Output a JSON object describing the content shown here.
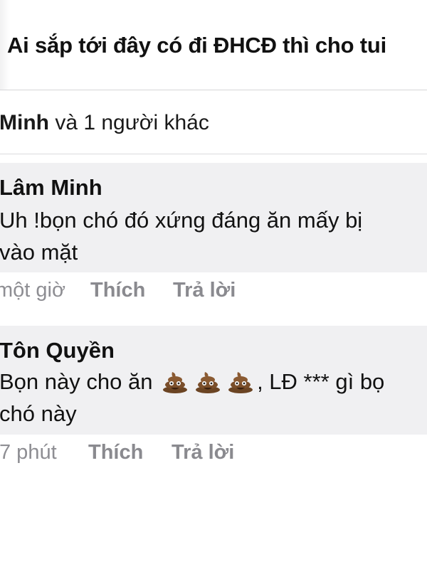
{
  "post": {
    "text": "Ai sắp tới đây có đi ĐHCĐ thì cho tui"
  },
  "reactions": {
    "name": "Minh",
    "rest": " và 1 người khác"
  },
  "comments": [
    {
      "author": "Lâm Minh",
      "line1": "Uh !bọn chó đó xứng đáng ăn mấy bị",
      "line2": "vào mặt",
      "time": "một giờ",
      "like_label": "Thích",
      "reply_label": "Trả lời"
    },
    {
      "author": "Tôn Quyền",
      "line1_start": "Bọn này cho ăn",
      "emoji": [
        "pile-of-poo",
        "pile-of-poo",
        "pile-of-poo"
      ],
      "line1_end": ", LĐ *** gì bọ",
      "line2": "chó này",
      "time": "7 phút",
      "like_label": "Thích",
      "reply_label": "Trả lời"
    }
  ],
  "colors": {
    "text": "#111111",
    "meta": "#8e8e93",
    "bubble": "#f0f0f2",
    "divider": "#d6d6d8"
  }
}
